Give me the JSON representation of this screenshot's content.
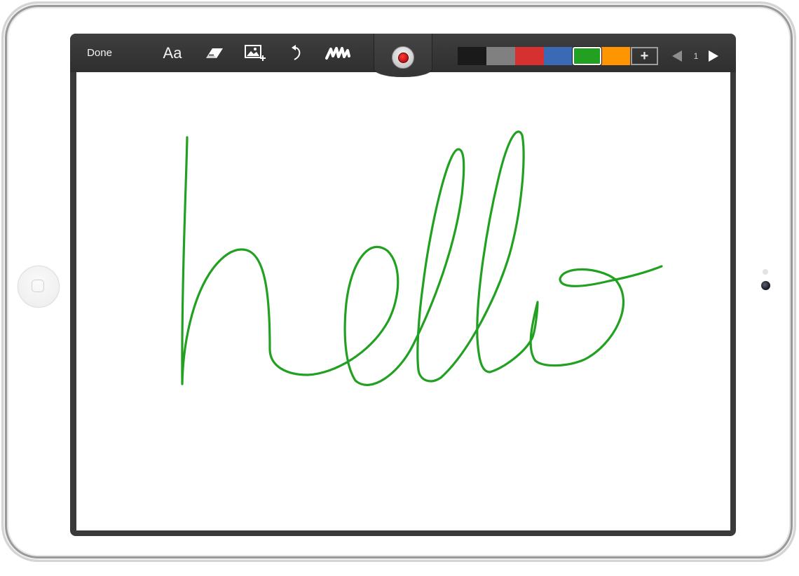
{
  "toolbar": {
    "done_label": "Done",
    "text_tool_label": "Aa",
    "tools": [
      "text-tool",
      "eraser-icon",
      "insert-image-icon",
      "undo-icon",
      "clear-scribble-icon"
    ],
    "record": {
      "icon": "record-icon",
      "color": "#c00000"
    },
    "palette": {
      "colors": [
        "#1a1a1a",
        "#808080",
        "#d63131",
        "#3a6ab3",
        "#22a022",
        "#ff9500"
      ],
      "selected": "#22a022"
    },
    "add_color_label": "+",
    "pagination": {
      "prev_icon": "triangle-left-icon",
      "next_icon": "triangle-right-icon",
      "current_page": "1"
    }
  },
  "canvas": {
    "background": "#ffffff",
    "stroke_color": "#22a022"
  }
}
